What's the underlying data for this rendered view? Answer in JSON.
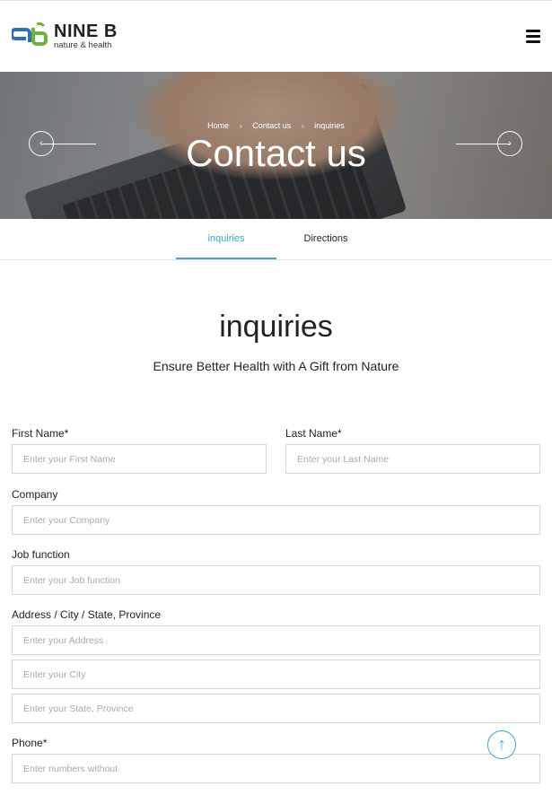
{
  "brand": {
    "name": "NINE B",
    "tagline": "nature & health",
    "colors": {
      "green": "#6bb33a",
      "blue": "#2e6fb6"
    }
  },
  "hero": {
    "breadcrumb": [
      "Home",
      "Contact us",
      "inquiries"
    ],
    "title": "Contact us"
  },
  "tabs": [
    {
      "label": "inquiries",
      "active": true
    },
    {
      "label": "Directions",
      "active": false
    }
  ],
  "section": {
    "title": "inquiries",
    "subtitle": "Ensure Better Health with A Gift from Nature"
  },
  "form": {
    "first_name": {
      "label": "First Name*",
      "placeholder": "Enter your First Name"
    },
    "last_name": {
      "label": "Last Name*",
      "placeholder": "Enter your Last Name"
    },
    "company": {
      "label": "Company",
      "placeholder": "Enter your Company"
    },
    "job": {
      "label": "Job function",
      "placeholder": "Enter your Job function"
    },
    "address": {
      "label": "Address / City / State, Province",
      "address_placeholder": "Enter your Address",
      "city_placeholder": "Enter your City",
      "state_placeholder": "Enter your State, Province"
    },
    "phone": {
      "label": "Phone*",
      "placeholder": "Enter numbers without"
    }
  },
  "icons": {
    "menu": "hamburger-icon",
    "prev": "arrow-left-icon",
    "next": "arrow-right-icon",
    "top": "arrow-up-icon"
  },
  "accent_color": "#3aa5d6"
}
